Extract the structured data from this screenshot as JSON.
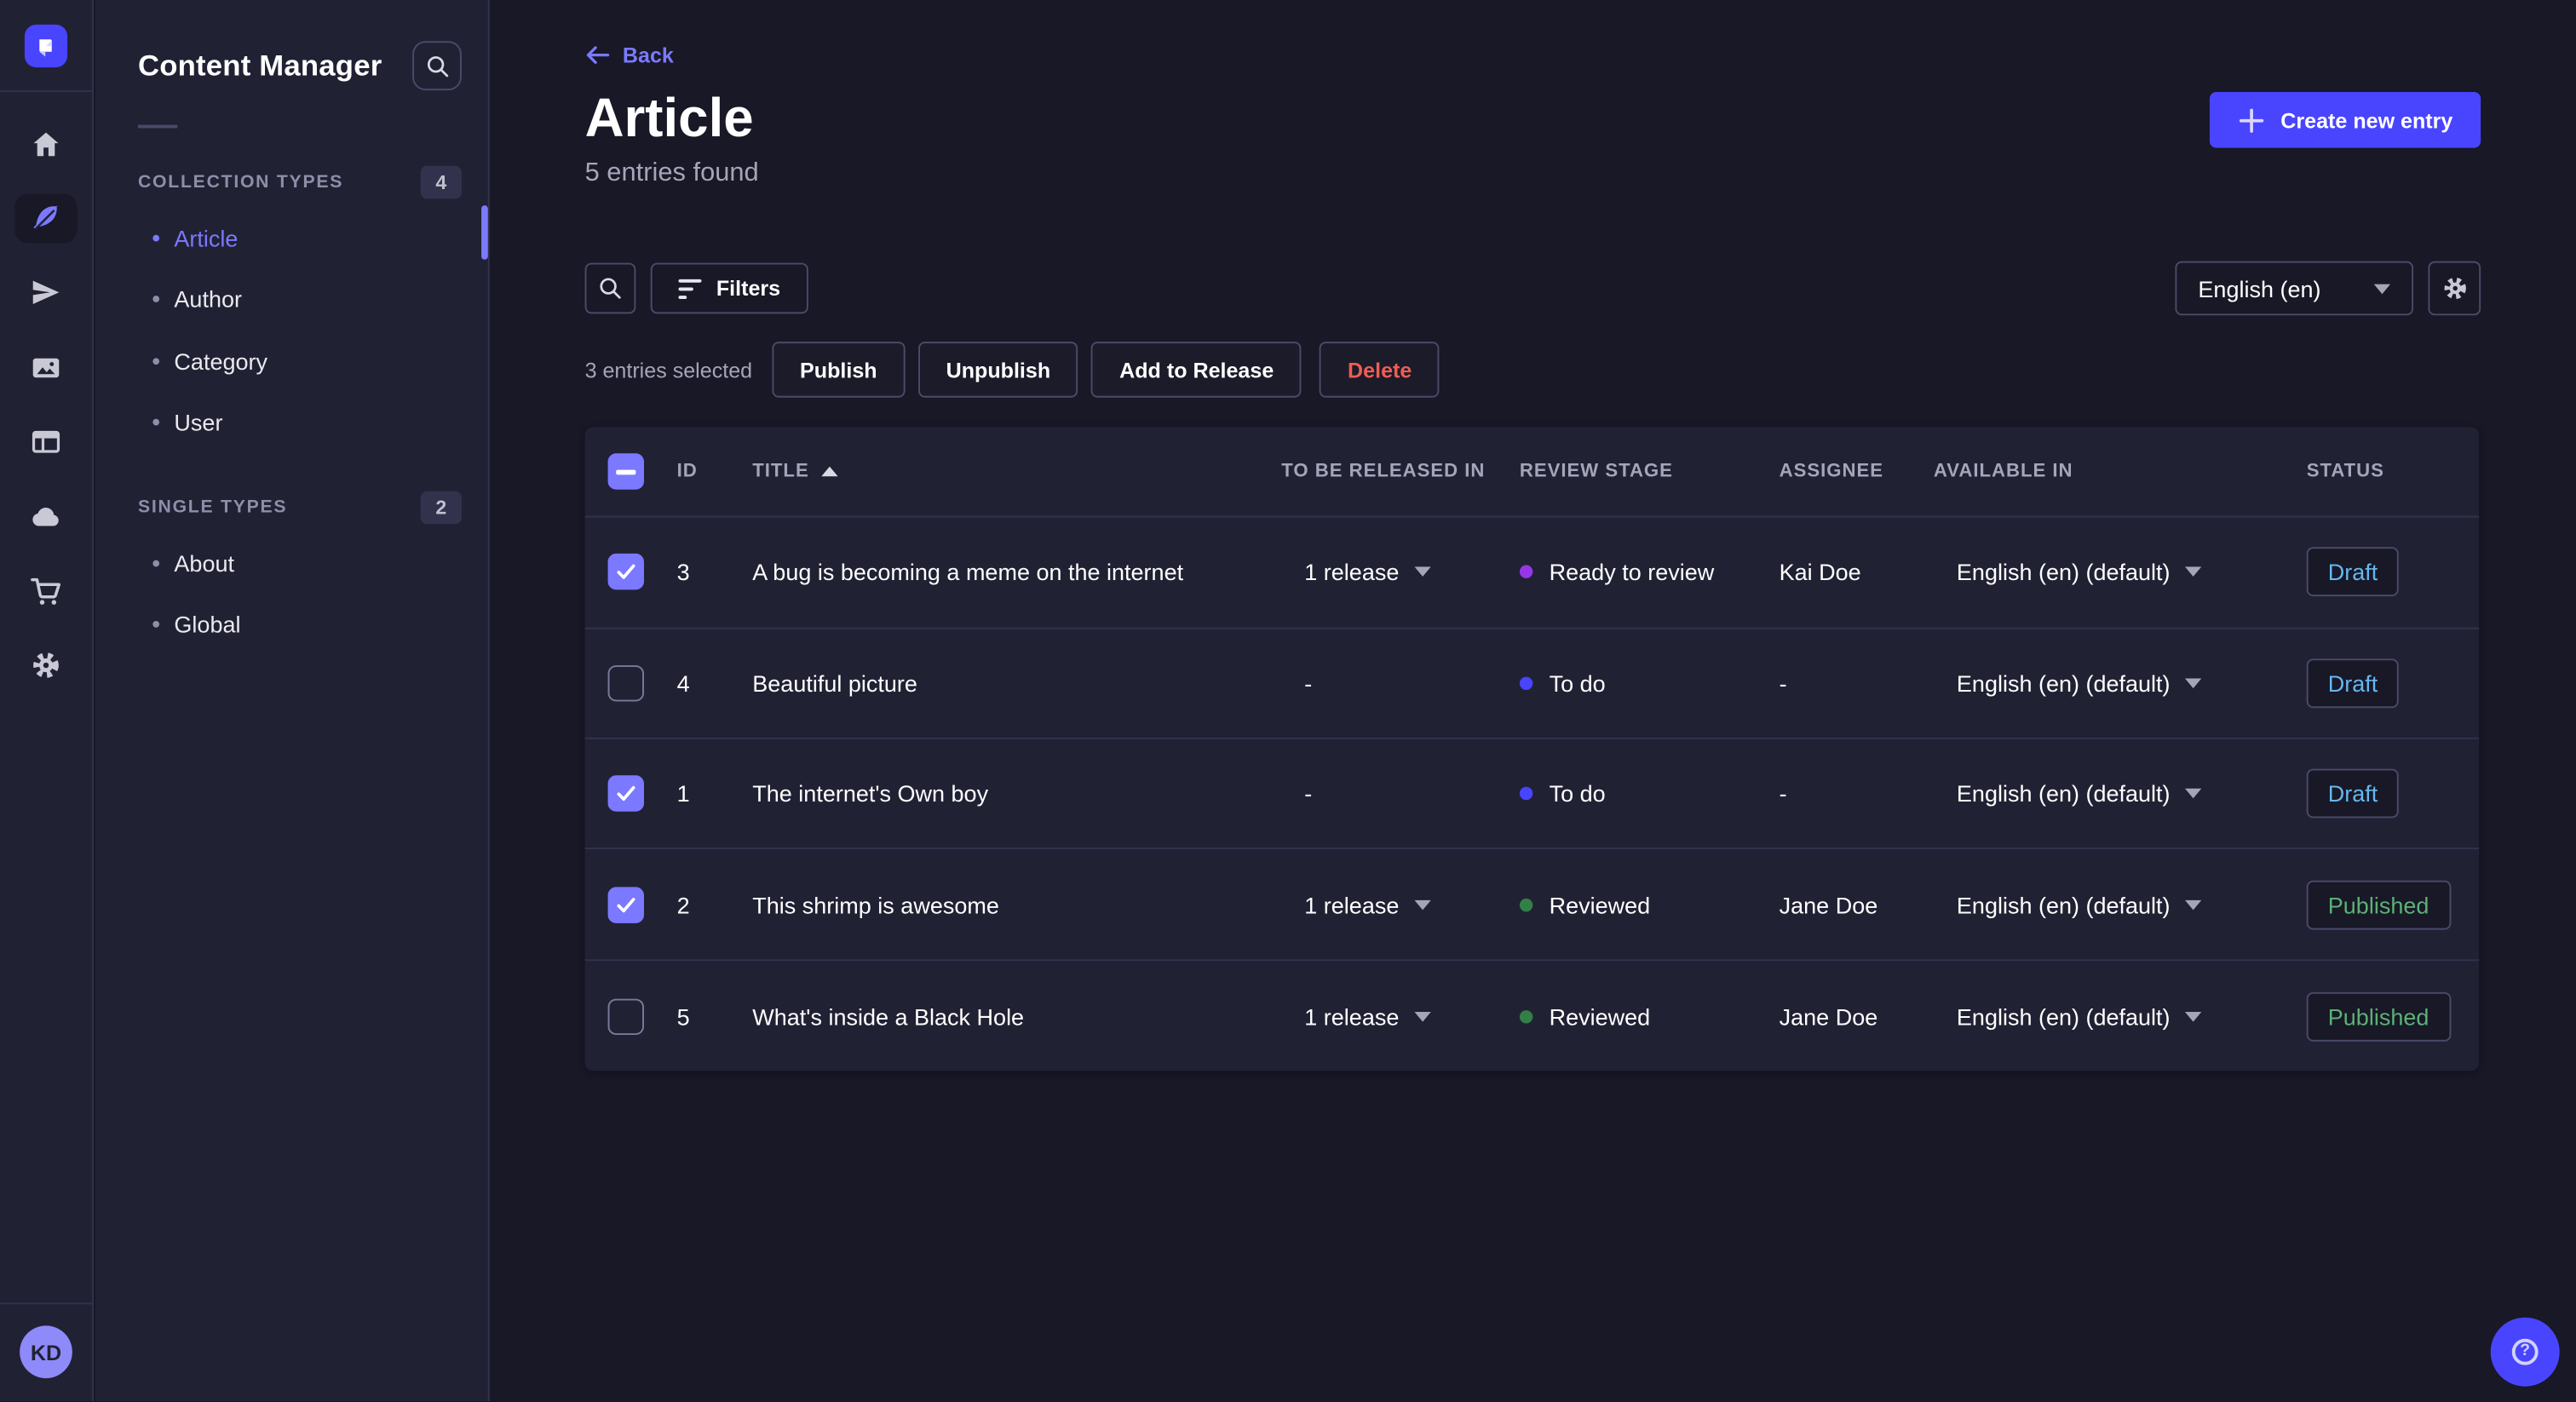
{
  "colors": {
    "page_bg": "#181826",
    "card_bg": "#212134",
    "border": "#32324d",
    "border_light": "#4a4a6a",
    "accent": "#4945ff",
    "accent_light": "#7b79ff",
    "text_muted": "#a5a5ba",
    "danger": "#ee5e52",
    "draft_text": "#66b7f1",
    "published_text": "#5cb176"
  },
  "mainnav": {
    "logo": "strapi-logo",
    "icons": [
      {
        "name": "home-icon",
        "active": false
      },
      {
        "name": "content-feather-icon",
        "active": true
      },
      {
        "name": "send-icon",
        "active": false
      },
      {
        "name": "media-library-icon",
        "active": false
      },
      {
        "name": "layout-icon",
        "active": false
      },
      {
        "name": "cloud-icon",
        "active": false
      },
      {
        "name": "cart-icon",
        "active": false
      },
      {
        "name": "gear-icon",
        "active": false
      }
    ],
    "avatar_initials": "KD"
  },
  "subnav": {
    "title": "Content Manager",
    "search_icon": "search-icon",
    "sections": [
      {
        "label": "COLLECTION TYPES",
        "count": "4",
        "items": [
          {
            "label": "Article",
            "active": true
          },
          {
            "label": "Author",
            "active": false
          },
          {
            "label": "Category",
            "active": false
          },
          {
            "label": "User",
            "active": false
          }
        ]
      },
      {
        "label": "SINGLE TYPES",
        "count": "2",
        "items": [
          {
            "label": "About",
            "active": false
          },
          {
            "label": "Global",
            "active": false
          }
        ]
      }
    ]
  },
  "header": {
    "back": "Back",
    "title": "Article",
    "subtitle": "5 entries found",
    "create_button": "Create new entry"
  },
  "toolbar": {
    "filters": "Filters",
    "locale": "English (en)"
  },
  "selection": {
    "text": "3 entries selected",
    "publish": "Publish",
    "unpublish": "Unpublish",
    "add_to_release": "Add to Release",
    "delete": "Delete"
  },
  "table": {
    "sorted_by": {
      "column": "TITLE",
      "direction": "ascending"
    },
    "headers": {
      "id": "ID",
      "title": "TITLE",
      "released": "TO BE RELEASED IN",
      "review": "REVIEW STAGE",
      "assignee": "ASSIGNEE",
      "available": "AVAILABLE IN",
      "status": "STATUS"
    },
    "header_checkbox_state": "indeterminate",
    "rows": [
      {
        "checked": true,
        "id": "3",
        "title": "A bug is becoming a meme on the internet",
        "released": "1 release",
        "released_dropdown": true,
        "review": {
          "label": "Ready to review",
          "color": "#9736e8"
        },
        "assignee": "Kai Doe",
        "available": "English (en) (default)",
        "status": "Draft"
      },
      {
        "checked": false,
        "id": "4",
        "title": "Beautiful picture",
        "released": "-",
        "released_dropdown": false,
        "review": {
          "label": "To do",
          "color": "#4945ff"
        },
        "assignee": "-",
        "available": "English (en) (default)",
        "status": "Draft"
      },
      {
        "checked": true,
        "id": "1",
        "title": "The internet's Own boy",
        "released": "-",
        "released_dropdown": false,
        "review": {
          "label": "To do",
          "color": "#4945ff"
        },
        "assignee": "-",
        "available": "English (en) (default)",
        "status": "Draft"
      },
      {
        "checked": true,
        "id": "2",
        "title": "This shrimp is awesome",
        "released": "1 release",
        "released_dropdown": true,
        "review": {
          "label": "Reviewed",
          "color": "#328048"
        },
        "assignee": "Jane Doe",
        "available": "English (en) (default)",
        "status": "Published"
      },
      {
        "checked": false,
        "id": "5",
        "title": "What's inside a Black Hole",
        "released": "1 release",
        "released_dropdown": true,
        "review": {
          "label": "Reviewed",
          "color": "#328048"
        },
        "assignee": "Jane Doe",
        "available": "English (en) (default)",
        "status": "Published"
      }
    ]
  },
  "help": {
    "icon": "question-circle-icon"
  }
}
